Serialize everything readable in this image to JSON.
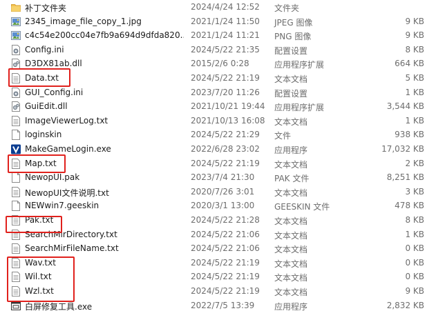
{
  "files": [
    {
      "name": "补丁文件夹",
      "date": "2024/4/24 12:52",
      "type": "文件夹",
      "size": "",
      "icon": "folder-icon"
    },
    {
      "name": "2345_image_file_copy_1.jpg",
      "date": "2021/1/24 11:50",
      "type": "JPEG 图像",
      "size": "9 KB",
      "icon": "image-file-icon"
    },
    {
      "name": "c4c54e200cc04e7fb9a694d9dfda820...",
      "date": "2021/1/24 11:21",
      "type": "PNG 图像",
      "size": "9 KB",
      "icon": "image-file-icon"
    },
    {
      "name": "Config.ini",
      "date": "2024/5/22 21:35",
      "type": "配置设置",
      "size": "8 KB",
      "icon": "config-file-icon"
    },
    {
      "name": "D3DX81ab.dll",
      "date": "2015/2/6 0:28",
      "type": "应用程序扩展",
      "size": "664 KB",
      "icon": "dll-file-icon"
    },
    {
      "name": "Data.txt",
      "date": "2024/5/22 21:19",
      "type": "文本文档",
      "size": "5 KB",
      "icon": "text-file-icon"
    },
    {
      "name": "GUI_Config.ini",
      "date": "2023/7/20 11:26",
      "type": "配置设置",
      "size": "1 KB",
      "icon": "config-file-icon"
    },
    {
      "name": "GuiEdit.dll",
      "date": "2021/10/21 19:44",
      "type": "应用程序扩展",
      "size": "3,544 KB",
      "icon": "dll-file-icon"
    },
    {
      "name": "ImageViewerLog.txt",
      "date": "2021/10/13 16:08",
      "type": "文本文档",
      "size": "1 KB",
      "icon": "text-file-icon"
    },
    {
      "name": "loginskin",
      "date": "2024/5/22 21:29",
      "type": "文件",
      "size": "938 KB",
      "icon": "blank-file-icon"
    },
    {
      "name": "MakeGameLogin.exe",
      "date": "2022/6/28 23:02",
      "type": "应用程序",
      "size": "17,032 KB",
      "icon": "app-v-icon"
    },
    {
      "name": "Map.txt",
      "date": "2024/5/22 21:19",
      "type": "文本文档",
      "size": "2 KB",
      "icon": "text-file-icon"
    },
    {
      "name": "NewopUI.pak",
      "date": "2023/7/4 21:30",
      "type": "PAK 文件",
      "size": "8,251 KB",
      "icon": "blank-file-icon"
    },
    {
      "name": "NewopUI文件说明.txt",
      "date": "2020/7/26 3:01",
      "type": "文本文档",
      "size": "3 KB",
      "icon": "text-file-icon"
    },
    {
      "name": "NEWwin7.geeskin",
      "date": "2020/3/1 13:00",
      "type": "GEESKIN 文件",
      "size": "478 KB",
      "icon": "blank-file-icon"
    },
    {
      "name": "Pak.txt",
      "date": "2024/5/22 21:28",
      "type": "文本文档",
      "size": "8 KB",
      "icon": "text-file-icon"
    },
    {
      "name": "SearchMirDirectory.txt",
      "date": "2024/5/22 21:06",
      "type": "文本文档",
      "size": "1 KB",
      "icon": "text-file-icon"
    },
    {
      "name": "SearchMirFileName.txt",
      "date": "2024/5/22 21:06",
      "type": "文本文档",
      "size": "0 KB",
      "icon": "text-file-icon"
    },
    {
      "name": "Wav.txt",
      "date": "2024/5/22 21:19",
      "type": "文本文档",
      "size": "0 KB",
      "icon": "text-file-icon"
    },
    {
      "name": "Wil.txt",
      "date": "2024/5/22 21:19",
      "type": "文本文档",
      "size": "0 KB",
      "icon": "text-file-icon"
    },
    {
      "name": "Wzl.txt",
      "date": "2024/5/22 21:19",
      "type": "文本文档",
      "size": "9 KB",
      "icon": "text-file-icon"
    },
    {
      "name": "白屏修复工具.exe",
      "date": "2022/7/5 13:39",
      "type": "应用程序",
      "size": "2,832 KB",
      "icon": "app-window-icon"
    }
  ],
  "colors": {
    "highlight_box": "#e0201c",
    "folder": "#f2c14e",
    "secondary_text": "#6d6d6d"
  }
}
